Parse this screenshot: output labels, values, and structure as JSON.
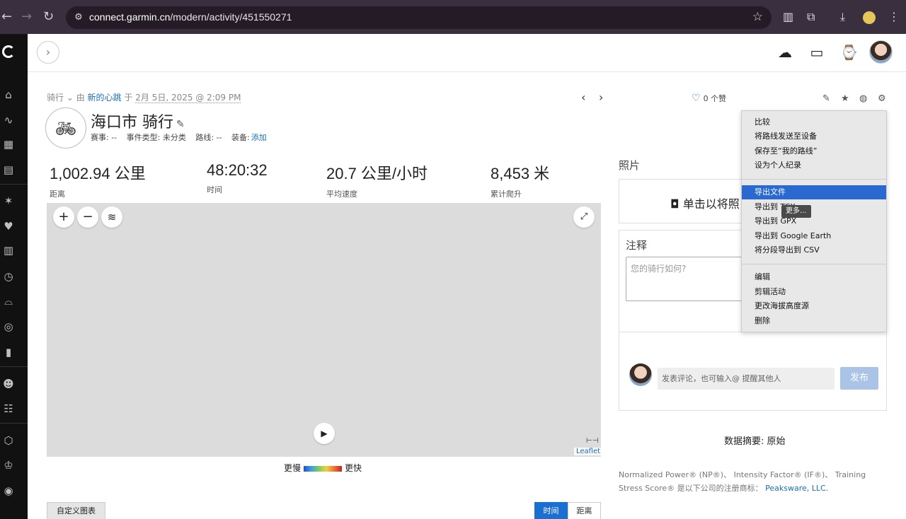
{
  "browser": {
    "url_host": "connect.garmin.cn",
    "url_path": "/modern/activity/451550271"
  },
  "breadcrumb": {
    "type": "骑行",
    "by": "由",
    "user": "新的心跳",
    "at": "于",
    "date": "2月 5日, 2025 @ 2:09 PM"
  },
  "activity": {
    "title": "海口市 骑行",
    "meta": {
      "event": "赛事: --",
      "event_type": "事件类型: 未分类",
      "route": "路线: --",
      "gear_label": "装备:",
      "gear_add": "添加"
    }
  },
  "stats": [
    {
      "value": "1,002.94 公里",
      "label": "距离"
    },
    {
      "value": "48:20:32",
      "label": "时间"
    },
    {
      "value": "20.7 公里/小时",
      "label": "平均速度"
    },
    {
      "value": "8,453 米",
      "label": "累计爬升"
    }
  ],
  "map": {
    "zoom_in": "+",
    "zoom_out": "−",
    "attribution": "Leaflet",
    "legend_slow": "更慢",
    "legend_fast": "更快"
  },
  "chart_controls": {
    "custom": "自定义图表",
    "time": "时间",
    "distance": "距离"
  },
  "right": {
    "likes": "0 个赞",
    "photos_heading": "照片",
    "photos_upload": "单击以将照",
    "notes_heading": "注释",
    "notes_placeholder": "您的骑行如何?",
    "comment_placeholder": "发表评论，也可输入@ 提醒其他人",
    "publish": "发布",
    "summary": "数据摘要: 原始",
    "footnote": "Normalized Power® (NP®)、 Intensity Factor® (IF®)、 Training Stress Score® 是以下公司的注册商标：",
    "footnote_link": "Peaksware, LLC."
  },
  "menu": {
    "group1": [
      "比较",
      "将路线发送至设备",
      "保存至“我的路线”",
      "设为个人纪录"
    ],
    "group2": [
      "导出文件",
      "导出到 TCX",
      "导出到 GPX",
      "导出到 Google Earth",
      "将分段导出到 CSV"
    ],
    "group3": [
      "编辑",
      "剪辑活动",
      "更改海拔高度源",
      "删除"
    ],
    "tooltip": "更多..."
  }
}
